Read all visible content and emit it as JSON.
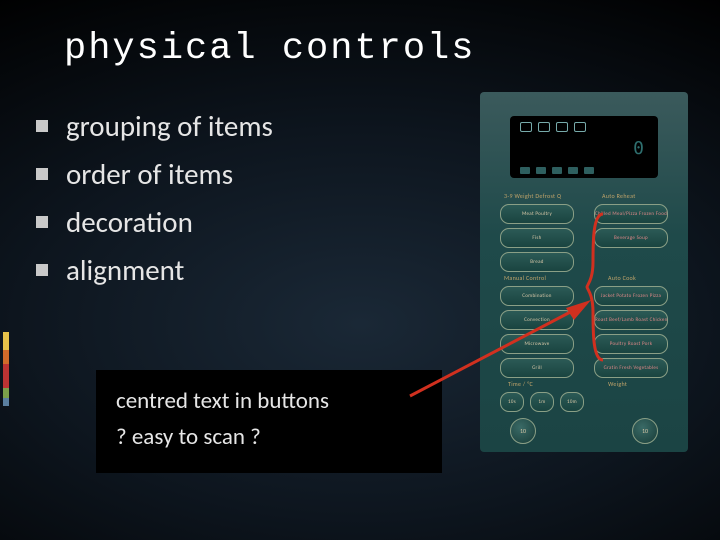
{
  "title": "physical controls",
  "bullets": [
    "grouping of items",
    "order of items",
    "decoration",
    "alignment"
  ],
  "sub_lines": [
    "centred text in buttons",
    "? easy to scan ?"
  ],
  "panel": {
    "display_digit": "0",
    "section_defrost": "3-9 Weight Defrost Q",
    "section_reheat": "Auto Reheat",
    "section_manual": "Manual Control",
    "section_autocook": "Auto Cook",
    "section_time": "Time / °C",
    "section_weight": "Weight",
    "left_buttons_top": [
      "Meat Poultry",
      "Fish",
      "Bread"
    ],
    "right_buttons_top": [
      "Chilled Meal/Pizza Frozen Food",
      "Beverage Soup"
    ],
    "left_buttons_mid": [
      "Combination",
      "Convection",
      "Microwave",
      "Grill"
    ],
    "right_buttons_mid": [
      "Jacket Potato Frozen Pizza",
      "Roast Beef/Lamb Roast Chicken",
      "Poultry Roast Pork",
      "Gratin Fresh Vegetables"
    ],
    "bottom_small": [
      "10s",
      "1m",
      "10m"
    ],
    "bottom_round": [
      "10",
      "10"
    ]
  }
}
